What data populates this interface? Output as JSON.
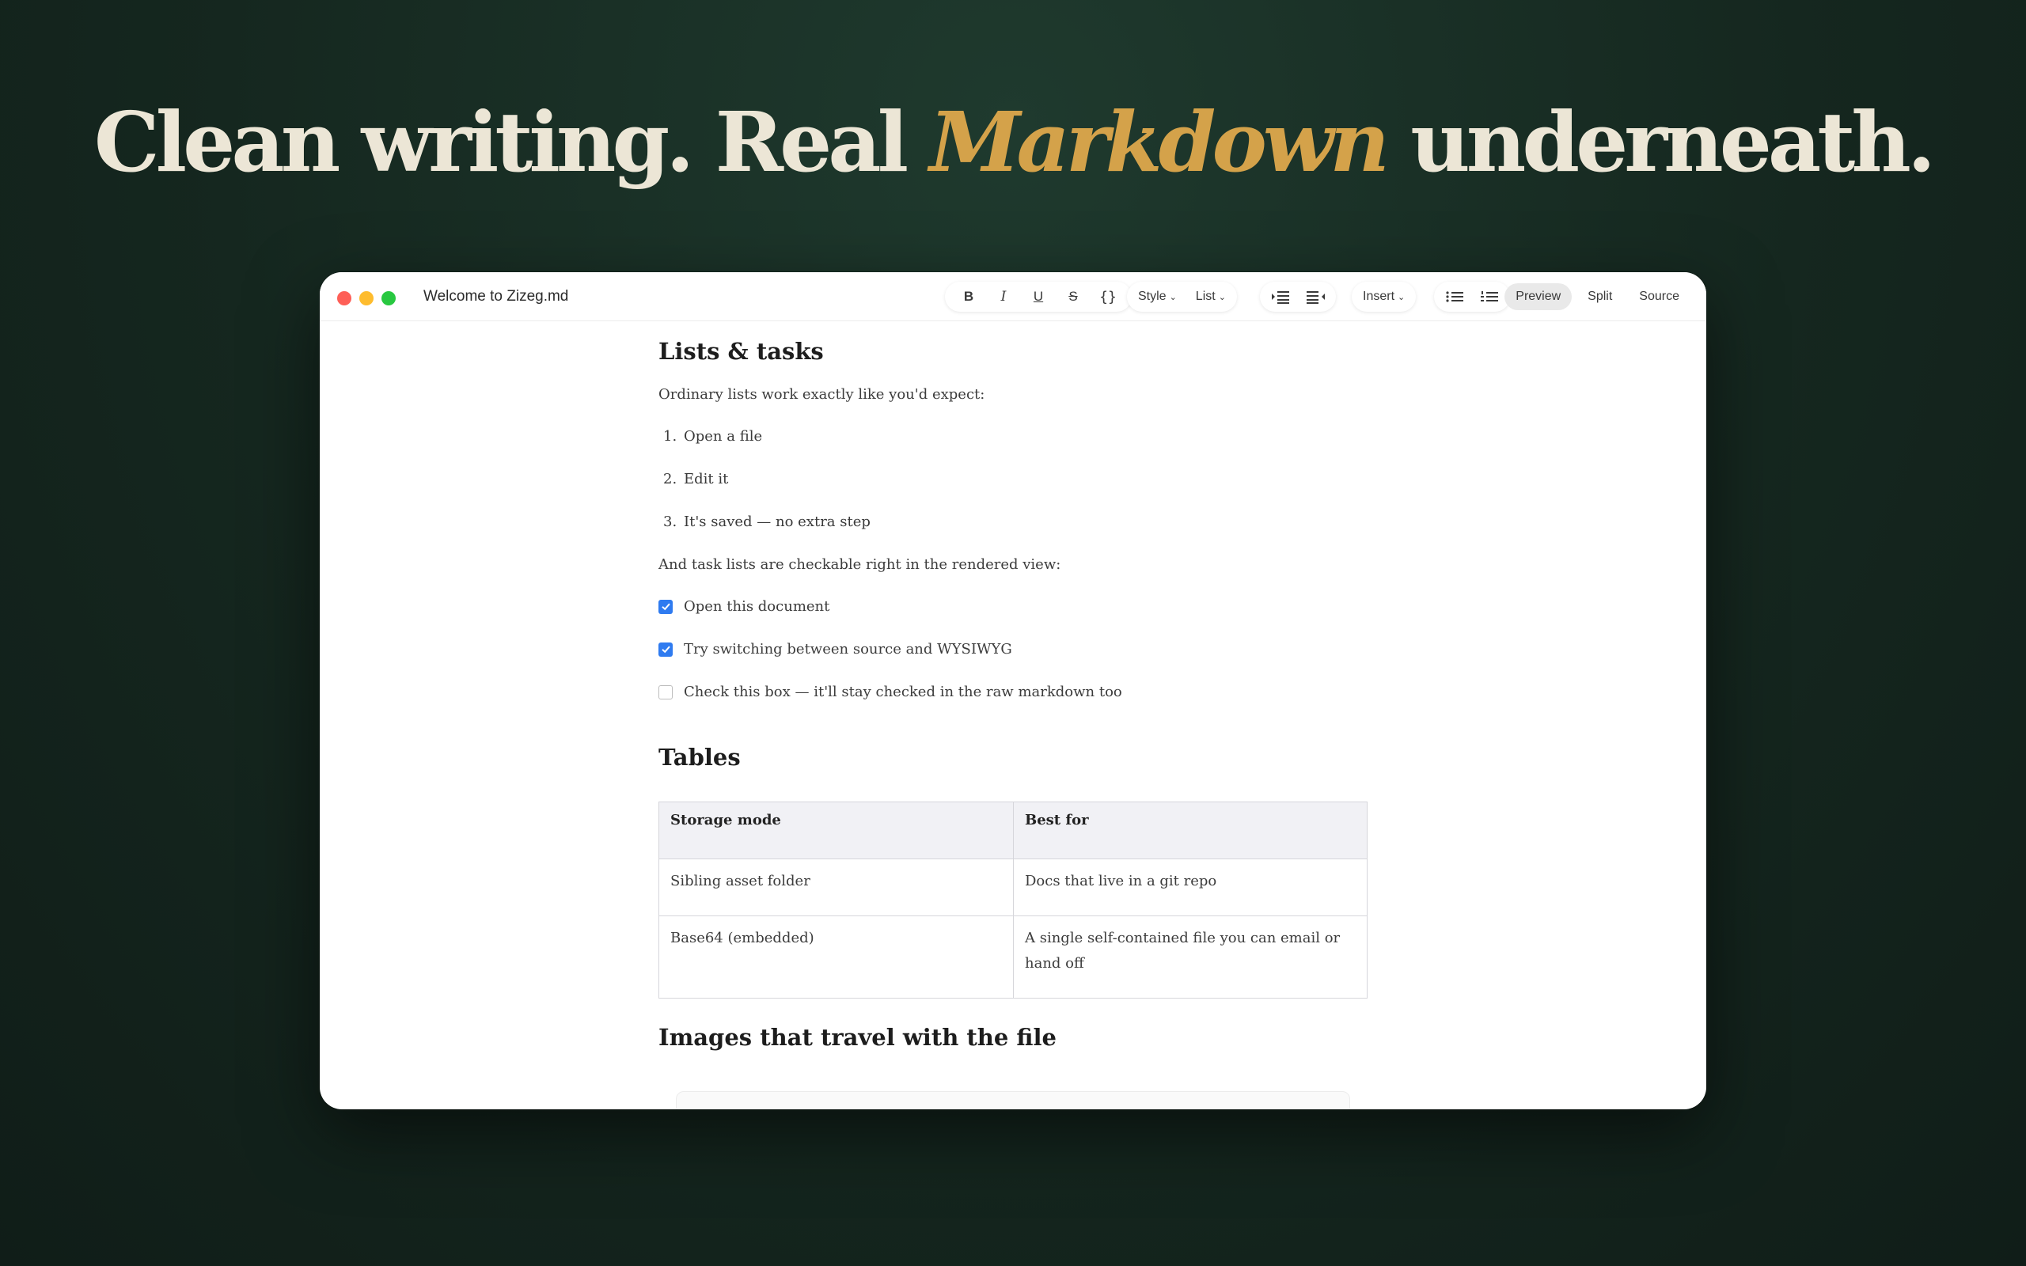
{
  "headline": {
    "pre": "Clean writing. Real ",
    "accent": "Markdown",
    "post": " underneath."
  },
  "window": {
    "title": "Welcome to Zizeg.md"
  },
  "toolbar": {
    "bold": "B",
    "italic": "I",
    "underline": "U",
    "strike": "S",
    "code": "{}",
    "style": "Style",
    "list": "List",
    "insert": "Insert",
    "modes": {
      "preview": "Preview",
      "split": "Split",
      "source": "Source"
    },
    "active_mode": "Preview"
  },
  "doc": {
    "lists_heading": "Lists & tasks",
    "lists_intro": "Ordinary lists work exactly like you'd expect:",
    "ordered": [
      {
        "num": "1.",
        "text": "Open a file"
      },
      {
        "num": "2.",
        "text": "Edit it"
      },
      {
        "num": "3.",
        "text": "It's saved — no extra step"
      }
    ],
    "tasks_intro": "And task lists are checkable right in the rendered view:",
    "tasks": [
      {
        "text": "Open this document",
        "checked": true
      },
      {
        "text": "Try switching between source and WYSIWYG",
        "checked": true
      },
      {
        "text": "Check this box — it'll stay checked in the raw markdown too",
        "checked": false
      }
    ],
    "tables_heading": "Tables",
    "table": {
      "headers": [
        "Storage mode",
        "Best for"
      ],
      "rows": [
        [
          "Sibling asset folder",
          "Docs that live in a git repo"
        ],
        [
          "Base64 (embedded)",
          "A single self-contained file you can email or hand off"
        ]
      ]
    },
    "images_heading": "Images that travel with the file"
  },
  "colors": {
    "accent": "#d4a24a",
    "checkbox": "#2f7bf0"
  }
}
